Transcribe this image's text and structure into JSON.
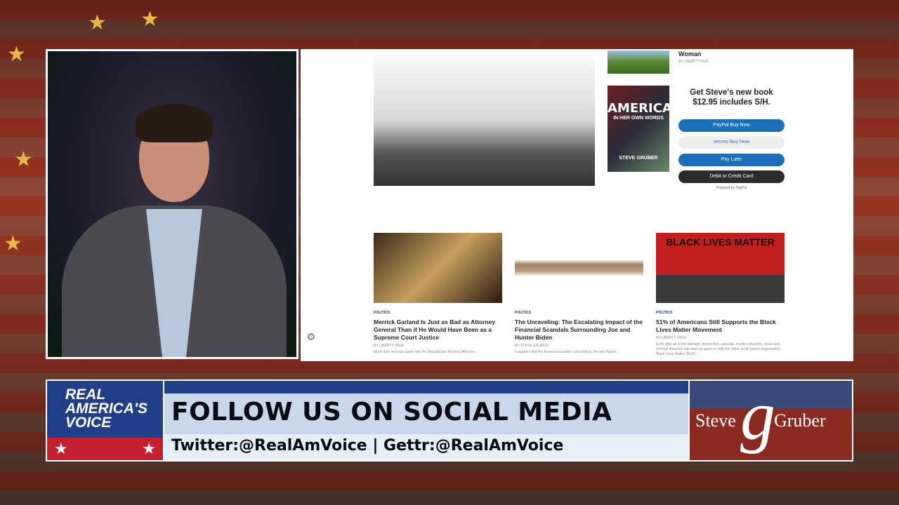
{
  "website": {
    "sidebar_article": {
      "title": "Woman",
      "byline": "BY LIBERTY PAGE"
    },
    "book": {
      "cover_title": "AMERICA",
      "cover_subtitle": "IN HER OWN WORDS",
      "cover_author": "STEVE GRUBER"
    },
    "promo": {
      "line1": "Get Steve's new book",
      "line2": "$12.95 includes S/H."
    },
    "buttons": [
      "PayPal Buy Now",
      "venmo Buy Now",
      "Pay Later",
      "Debit or Credit Card"
    ],
    "powered_by": "Powered by PayPal",
    "articles": [
      {
        "category": "POLITICS",
        "title": "Merrick Garland Is Just as Bad as Attorney General Than if He Would Have Been as a Supreme Court Justice",
        "byline": "BY LIBERTY PAGE",
        "excerpt": "Much time and was spent with the Republicans blocking Attorney..."
      },
      {
        "category": "POLITICS",
        "title": "The Unraveling: The Escalating Impact of the Financial Scandals Surrounding Joe and Hunter Biden",
        "byline": "BY STEVE GRUBER",
        "excerpt": "It appears that the financial scandals surrounding Joe and Hunter..."
      },
      {
        "category": "POLITICS",
        "title": "51% of Americans Still Supports the Black Lives Matter Movement",
        "byline": "BY LIBERTY PAGE",
        "excerpt": "Even after all of the damage, destruction, assaults, murder, mayhem, arson and criminal financial crap that has gone on with the leftist social justice organization, Black Lives Matter (BLM)..."
      }
    ],
    "blm_sign": "BLACK LIVES MATTER"
  },
  "lower_third": {
    "network_logo": "REAL AMERICA'S VOICE",
    "headline": "FOLLOW US ON SOCIAL MEDIA",
    "handles": "Twitter:@RealAmVoice | Gettr:@RealAmVoice",
    "show_logo_first": "Steve",
    "show_logo_last": "Gruber",
    "show_logo_mark": "g"
  }
}
